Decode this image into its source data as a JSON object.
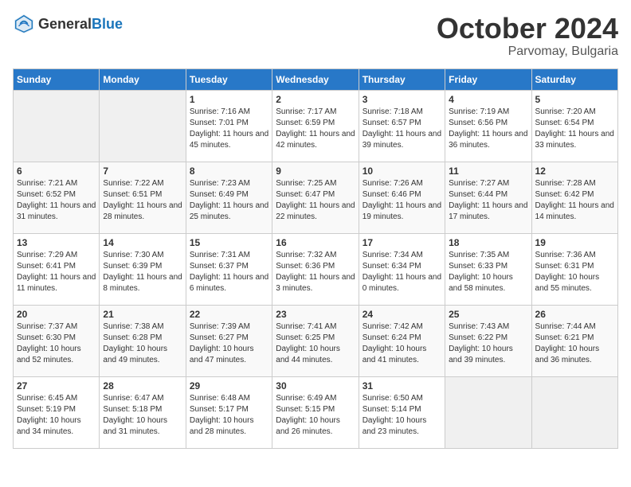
{
  "header": {
    "logo_general": "General",
    "logo_blue": "Blue",
    "month_title": "October 2024",
    "location": "Parvomay, Bulgaria"
  },
  "days_of_week": [
    "Sunday",
    "Monday",
    "Tuesday",
    "Wednesday",
    "Thursday",
    "Friday",
    "Saturday"
  ],
  "weeks": [
    [
      {
        "num": "",
        "empty": true
      },
      {
        "num": "",
        "empty": true
      },
      {
        "num": "1",
        "sunrise": "Sunrise: 7:16 AM",
        "sunset": "Sunset: 7:01 PM",
        "daylight": "Daylight: 11 hours and 45 minutes."
      },
      {
        "num": "2",
        "sunrise": "Sunrise: 7:17 AM",
        "sunset": "Sunset: 6:59 PM",
        "daylight": "Daylight: 11 hours and 42 minutes."
      },
      {
        "num": "3",
        "sunrise": "Sunrise: 7:18 AM",
        "sunset": "Sunset: 6:57 PM",
        "daylight": "Daylight: 11 hours and 39 minutes."
      },
      {
        "num": "4",
        "sunrise": "Sunrise: 7:19 AM",
        "sunset": "Sunset: 6:56 PM",
        "daylight": "Daylight: 11 hours and 36 minutes."
      },
      {
        "num": "5",
        "sunrise": "Sunrise: 7:20 AM",
        "sunset": "Sunset: 6:54 PM",
        "daylight": "Daylight: 11 hours and 33 minutes."
      }
    ],
    [
      {
        "num": "6",
        "sunrise": "Sunrise: 7:21 AM",
        "sunset": "Sunset: 6:52 PM",
        "daylight": "Daylight: 11 hours and 31 minutes."
      },
      {
        "num": "7",
        "sunrise": "Sunrise: 7:22 AM",
        "sunset": "Sunset: 6:51 PM",
        "daylight": "Daylight: 11 hours and 28 minutes."
      },
      {
        "num": "8",
        "sunrise": "Sunrise: 7:23 AM",
        "sunset": "Sunset: 6:49 PM",
        "daylight": "Daylight: 11 hours and 25 minutes."
      },
      {
        "num": "9",
        "sunrise": "Sunrise: 7:25 AM",
        "sunset": "Sunset: 6:47 PM",
        "daylight": "Daylight: 11 hours and 22 minutes."
      },
      {
        "num": "10",
        "sunrise": "Sunrise: 7:26 AM",
        "sunset": "Sunset: 6:46 PM",
        "daylight": "Daylight: 11 hours and 19 minutes."
      },
      {
        "num": "11",
        "sunrise": "Sunrise: 7:27 AM",
        "sunset": "Sunset: 6:44 PM",
        "daylight": "Daylight: 11 hours and 17 minutes."
      },
      {
        "num": "12",
        "sunrise": "Sunrise: 7:28 AM",
        "sunset": "Sunset: 6:42 PM",
        "daylight": "Daylight: 11 hours and 14 minutes."
      }
    ],
    [
      {
        "num": "13",
        "sunrise": "Sunrise: 7:29 AM",
        "sunset": "Sunset: 6:41 PM",
        "daylight": "Daylight: 11 hours and 11 minutes."
      },
      {
        "num": "14",
        "sunrise": "Sunrise: 7:30 AM",
        "sunset": "Sunset: 6:39 PM",
        "daylight": "Daylight: 11 hours and 8 minutes."
      },
      {
        "num": "15",
        "sunrise": "Sunrise: 7:31 AM",
        "sunset": "Sunset: 6:37 PM",
        "daylight": "Daylight: 11 hours and 6 minutes."
      },
      {
        "num": "16",
        "sunrise": "Sunrise: 7:32 AM",
        "sunset": "Sunset: 6:36 PM",
        "daylight": "Daylight: 11 hours and 3 minutes."
      },
      {
        "num": "17",
        "sunrise": "Sunrise: 7:34 AM",
        "sunset": "Sunset: 6:34 PM",
        "daylight": "Daylight: 11 hours and 0 minutes."
      },
      {
        "num": "18",
        "sunrise": "Sunrise: 7:35 AM",
        "sunset": "Sunset: 6:33 PM",
        "daylight": "Daylight: 10 hours and 58 minutes."
      },
      {
        "num": "19",
        "sunrise": "Sunrise: 7:36 AM",
        "sunset": "Sunset: 6:31 PM",
        "daylight": "Daylight: 10 hours and 55 minutes."
      }
    ],
    [
      {
        "num": "20",
        "sunrise": "Sunrise: 7:37 AM",
        "sunset": "Sunset: 6:30 PM",
        "daylight": "Daylight: 10 hours and 52 minutes."
      },
      {
        "num": "21",
        "sunrise": "Sunrise: 7:38 AM",
        "sunset": "Sunset: 6:28 PM",
        "daylight": "Daylight: 10 hours and 49 minutes."
      },
      {
        "num": "22",
        "sunrise": "Sunrise: 7:39 AM",
        "sunset": "Sunset: 6:27 PM",
        "daylight": "Daylight: 10 hours and 47 minutes."
      },
      {
        "num": "23",
        "sunrise": "Sunrise: 7:41 AM",
        "sunset": "Sunset: 6:25 PM",
        "daylight": "Daylight: 10 hours and 44 minutes."
      },
      {
        "num": "24",
        "sunrise": "Sunrise: 7:42 AM",
        "sunset": "Sunset: 6:24 PM",
        "daylight": "Daylight: 10 hours and 41 minutes."
      },
      {
        "num": "25",
        "sunrise": "Sunrise: 7:43 AM",
        "sunset": "Sunset: 6:22 PM",
        "daylight": "Daylight: 10 hours and 39 minutes."
      },
      {
        "num": "26",
        "sunrise": "Sunrise: 7:44 AM",
        "sunset": "Sunset: 6:21 PM",
        "daylight": "Daylight: 10 hours and 36 minutes."
      }
    ],
    [
      {
        "num": "27",
        "sunrise": "Sunrise: 6:45 AM",
        "sunset": "Sunset: 5:19 PM",
        "daylight": "Daylight: 10 hours and 34 minutes."
      },
      {
        "num": "28",
        "sunrise": "Sunrise: 6:47 AM",
        "sunset": "Sunset: 5:18 PM",
        "daylight": "Daylight: 10 hours and 31 minutes."
      },
      {
        "num": "29",
        "sunrise": "Sunrise: 6:48 AM",
        "sunset": "Sunset: 5:17 PM",
        "daylight": "Daylight: 10 hours and 28 minutes."
      },
      {
        "num": "30",
        "sunrise": "Sunrise: 6:49 AM",
        "sunset": "Sunset: 5:15 PM",
        "daylight": "Daylight: 10 hours and 26 minutes."
      },
      {
        "num": "31",
        "sunrise": "Sunrise: 6:50 AM",
        "sunset": "Sunset: 5:14 PM",
        "daylight": "Daylight: 10 hours and 23 minutes."
      },
      {
        "num": "",
        "empty": true
      },
      {
        "num": "",
        "empty": true
      }
    ]
  ]
}
